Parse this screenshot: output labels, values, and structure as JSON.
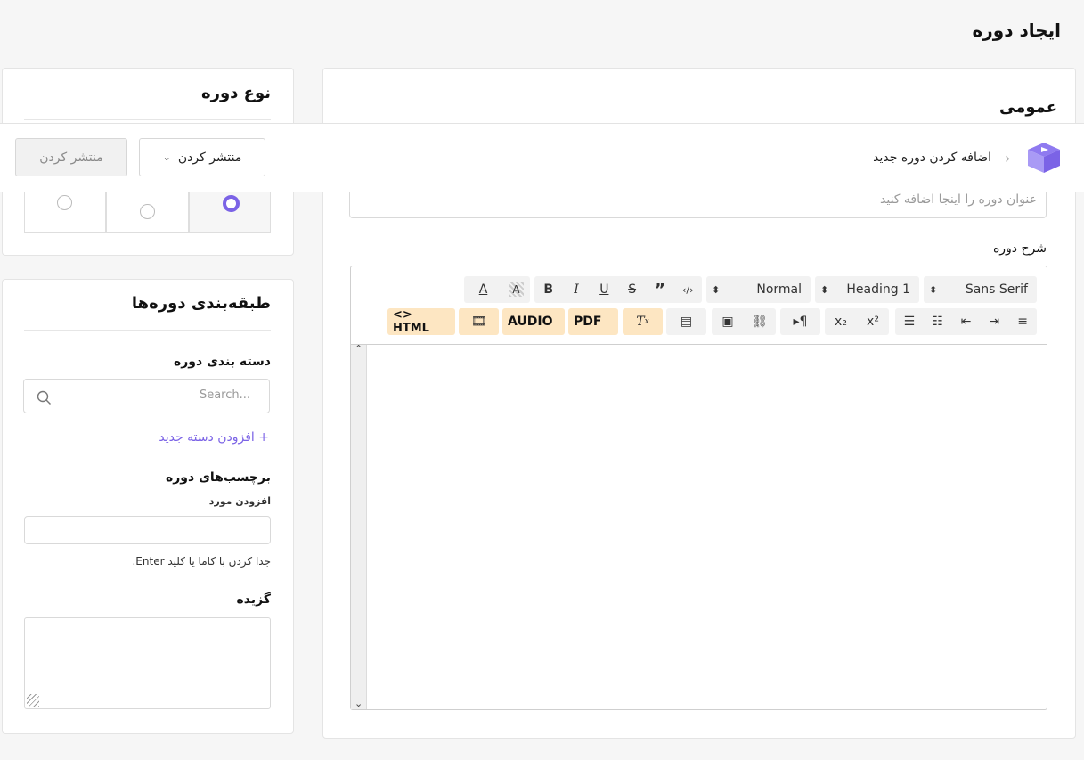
{
  "page": {
    "title": "ایجاد دوره"
  },
  "topbar": {
    "breadcrumb": "اضافه کردن دوره جدید",
    "publish_dropdown_label": "منتشر کردن",
    "publish_disabled_label": "منتشر کردن"
  },
  "general": {
    "heading": "عمومی",
    "title_placeholder": "عنوان دوره را اینجا اضافه کنید",
    "description_label": "شرح دوره"
  },
  "editor": {
    "font": "Sans Serif",
    "heading": "Heading 1",
    "size": "Normal",
    "pdf": "PDF",
    "audio": "AUDIO",
    "html": "<> HTML"
  },
  "course_type": {
    "heading": "نوع دوره"
  },
  "categories": {
    "heading": "طبقه‌بندی دوره‌ها",
    "category_label": "دسته بندی دوره",
    "search_placeholder": "Search...",
    "add_new": "+ افزودن دسته جدید",
    "tags_label": "برچسب‌های دوره",
    "add_item_label": "افزودن مورد",
    "tags_hint": "جدا کردن با کاما یا کلید Enter.",
    "excerpt_label": "گزیده"
  },
  "colors": {
    "accent": "#7b63e6",
    "highlight": "#fde6c2"
  }
}
